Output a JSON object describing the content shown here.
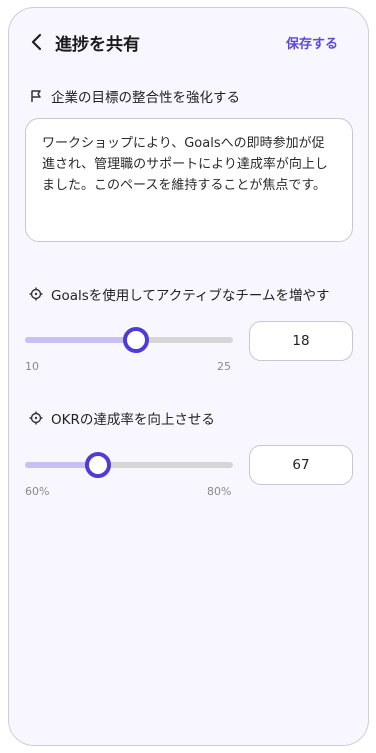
{
  "header": {
    "title": "進捗を共有",
    "save_label": "保存する"
  },
  "objective": {
    "label": "企業の目標の整合性を強化する",
    "icon": "flag-icon",
    "comment": "ワークショップにより、Goalsへの即時参加が促進され、管理職のサポートにより達成率が向上しました。このペースを維持することが焦点です。"
  },
  "key_results": [
    {
      "label": "Goalsを使用してアクティブなチームを増やす",
      "icon": "target-icon",
      "min_label": "10",
      "max_label": "25",
      "min": 10,
      "max": 25,
      "value": 18,
      "value_text": "18"
    },
    {
      "label": "OKRの達成率を向上させる",
      "icon": "target-icon",
      "min_label": "60%",
      "max_label": "80%",
      "min": 60,
      "max": 80,
      "value": 67,
      "value_text": "67"
    }
  ],
  "colors": {
    "accent": "#4f3bd6",
    "accent_light": "#c8c0f4",
    "link": "#5b4ad9",
    "background": "#f8f7ff"
  }
}
